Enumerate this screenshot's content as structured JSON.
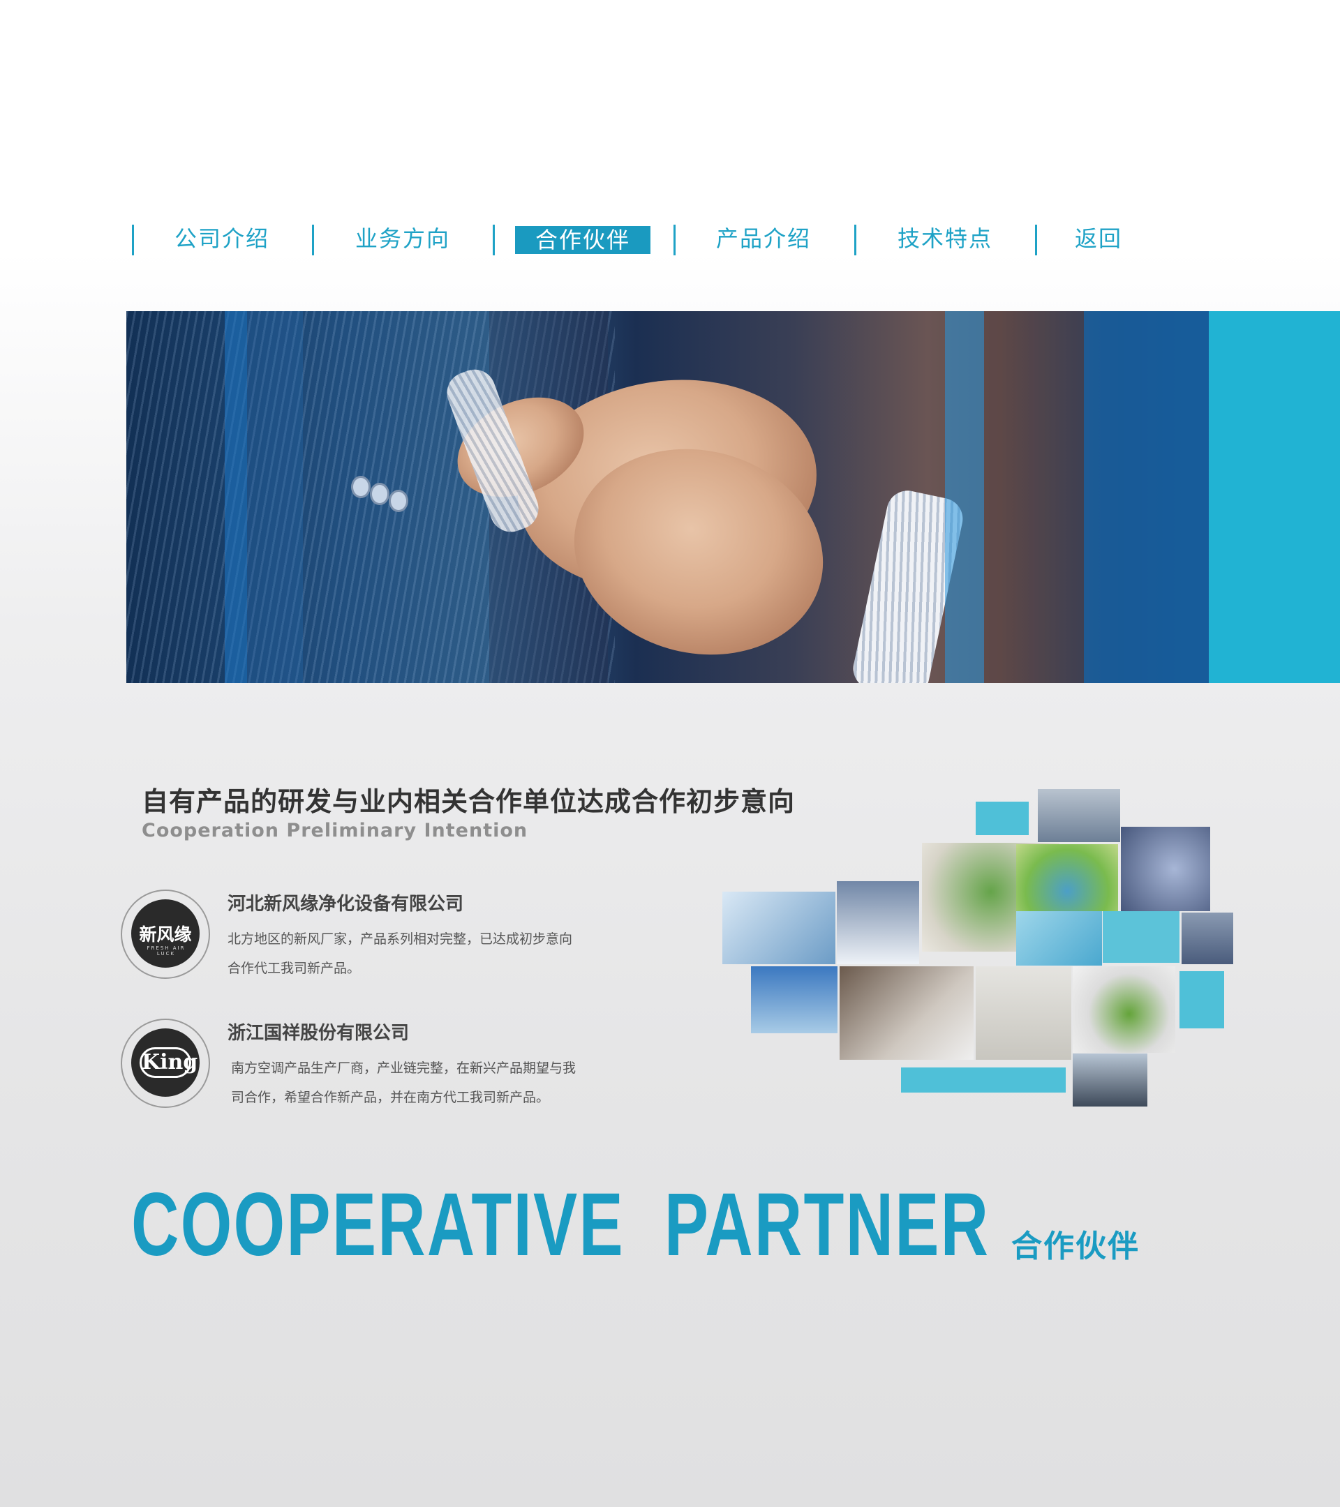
{
  "nav": {
    "items": [
      {
        "label": "公司介绍",
        "active": false
      },
      {
        "label": "业务方向",
        "active": false
      },
      {
        "label": "合作伙伴",
        "active": true
      },
      {
        "label": "产品介绍",
        "active": false
      },
      {
        "label": "技术特点",
        "active": false
      },
      {
        "label": "返回",
        "active": false
      }
    ]
  },
  "section": {
    "title_zh": "自有产品的研发与业内相关合作单位达成合作初步意向",
    "title_en": "Cooperation Preliminary Intention"
  },
  "partners": [
    {
      "name": "河北新风缘净化设备有限公司",
      "desc_line1": "北方地区的新风厂家，产品系列相对完整，已达成初步意向",
      "desc_line2": "合作代工我司新产品。",
      "logo_text": "新风缘",
      "logo_subtext": "FRESH AIR LUCK"
    },
    {
      "name": "浙江国祥股份有限公司",
      "desc_line1": "南方空调产品生产厂商，产业链完整，在新兴产品期望与我",
      "desc_line2": "司合作，希望合作新产品，并在南方代工我司新产品。",
      "logo_text": "King"
    }
  ],
  "footer": {
    "title_en": "COOPERATIVE  PARTNER",
    "title_zh": "合作伙伴"
  },
  "colors": {
    "accent": "#1a9bc2",
    "nav_active_bg": "#1a9ac0",
    "collage_block": "#4fc0d8"
  }
}
